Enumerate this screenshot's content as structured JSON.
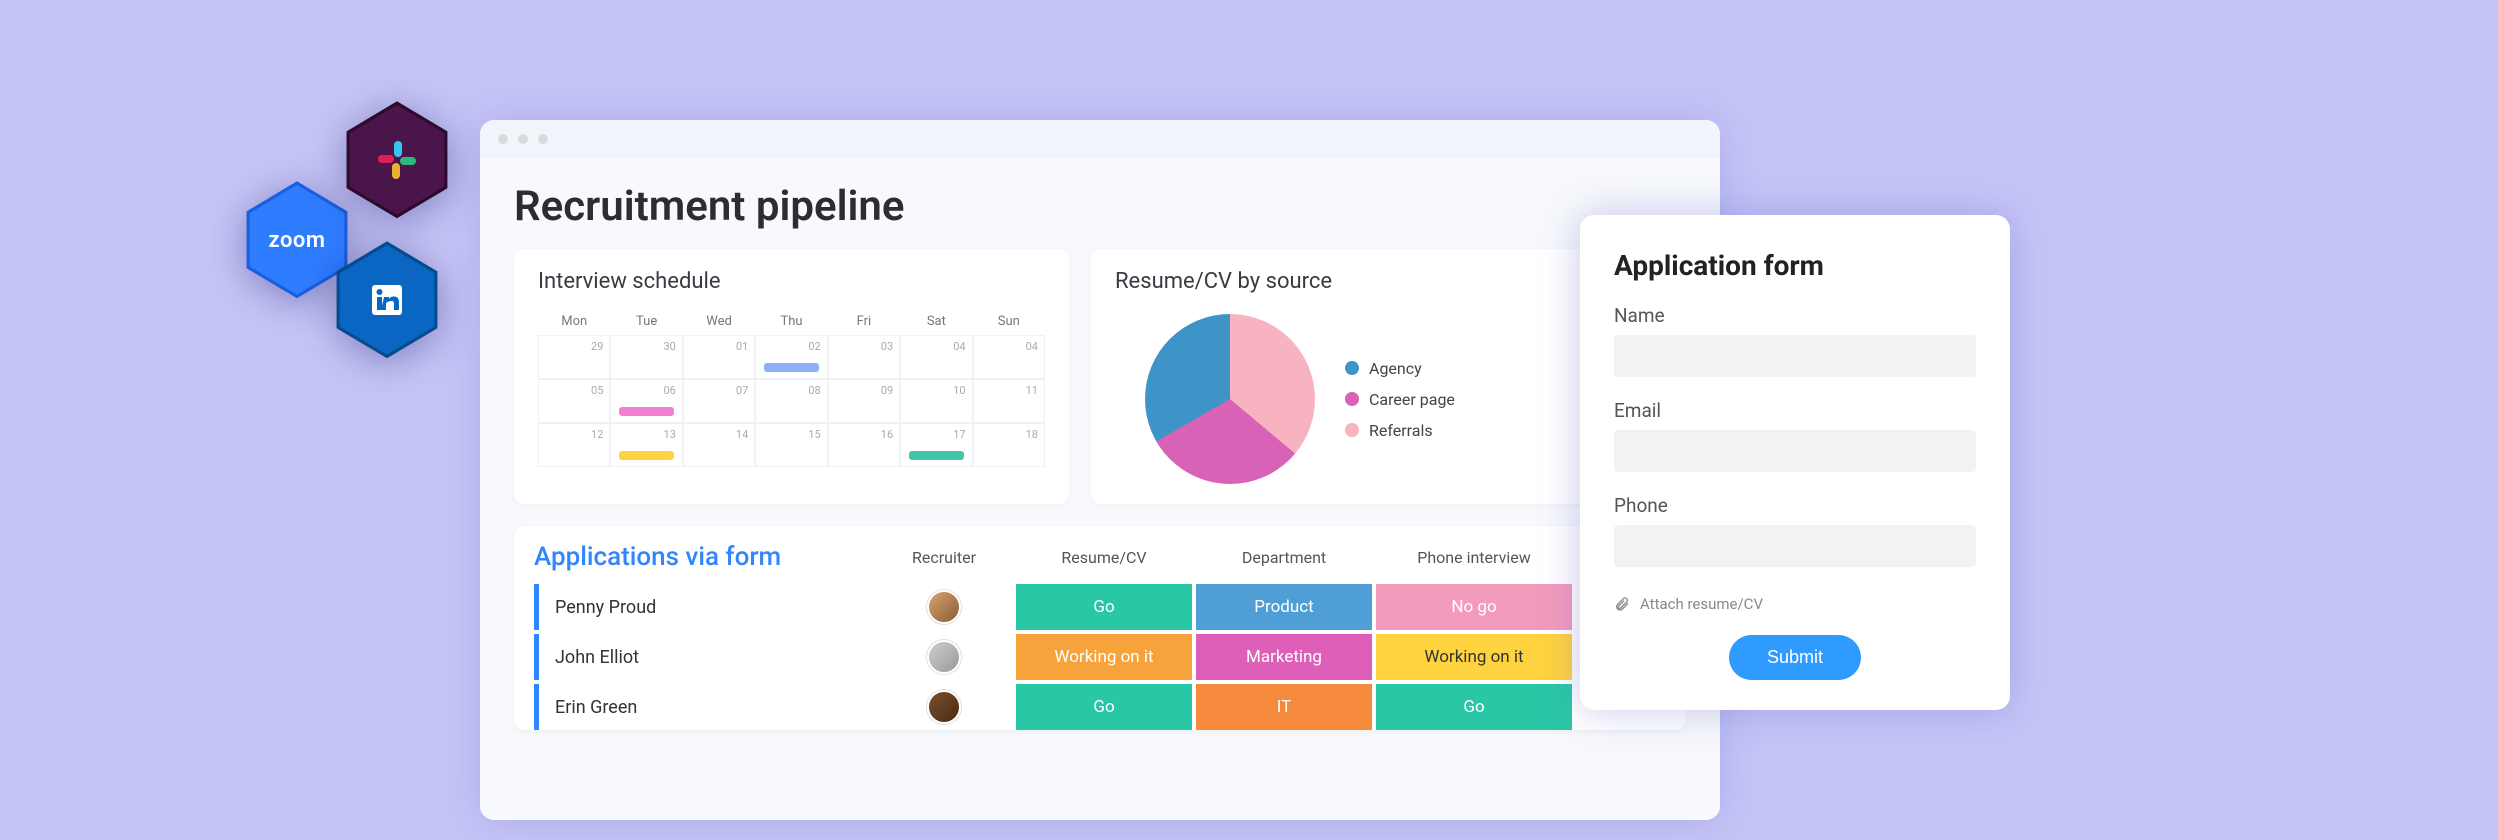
{
  "integrations": {
    "zoom_label": "zoom",
    "slack_name": "slack",
    "linkedin_name": "linkedin"
  },
  "window": {
    "title": "Recruitment pipeline"
  },
  "calendar": {
    "title": "Interview schedule",
    "days": [
      "Mon",
      "Tue",
      "Wed",
      "Thu",
      "Fri",
      "Sat",
      "Sun"
    ],
    "weeks": [
      [
        "29",
        "30",
        "01",
        "02",
        "03",
        "04",
        "04"
      ],
      [
        "05",
        "06",
        "07",
        "08",
        "09",
        "10",
        "11"
      ],
      [
        "12",
        "13",
        "14",
        "15",
        "16",
        "17",
        "18"
      ]
    ],
    "events": [
      {
        "row": 0,
        "col": 3,
        "color": "blue"
      },
      {
        "row": 1,
        "col": 1,
        "color": "pink"
      },
      {
        "row": 2,
        "col": 1,
        "color": "yellow"
      },
      {
        "row": 2,
        "col": 5,
        "color": "teal"
      }
    ]
  },
  "pie": {
    "title": "Resume/CV by source",
    "legend": [
      "Agency",
      "Career page",
      "Referrals"
    ]
  },
  "apps": {
    "title": "Applications via form",
    "cols": [
      "Recruiter",
      "Resume/CV",
      "Department",
      "Phone interview"
    ],
    "rows": [
      {
        "name": "Penny Proud",
        "resume": "Go",
        "resume_c": "st-teal",
        "dept": "Product",
        "dept_c": "st-blue",
        "phone": "No go",
        "phone_c": "st-pink",
        "av": "a"
      },
      {
        "name": "John Elliot",
        "resume": "Working on it",
        "resume_c": "st-orange",
        "dept": "Marketing",
        "dept_c": "st-mag",
        "phone": "Working on it",
        "phone_c": "st-yellow",
        "av": "b"
      },
      {
        "name": "Erin Green",
        "resume": "Go",
        "resume_c": "st-teal",
        "dept": "IT",
        "dept_c": "st-orange2",
        "phone": "Go",
        "phone_c": "st-teal",
        "av": "c"
      }
    ]
  },
  "form": {
    "title": "Application form",
    "fields": {
      "name": "Name",
      "email": "Email",
      "phone": "Phone"
    },
    "attach": "Attach resume/CV",
    "submit": "Submit"
  },
  "chart_data": {
    "type": "pie",
    "title": "Resume/CV by source",
    "series": [
      {
        "name": "Agency",
        "value": 33,
        "color": "#3f94c7"
      },
      {
        "name": "Career page",
        "value": 31,
        "color": "#d862b6"
      },
      {
        "name": "Referrals",
        "value": 36,
        "color": "#f7b3c0"
      }
    ]
  }
}
